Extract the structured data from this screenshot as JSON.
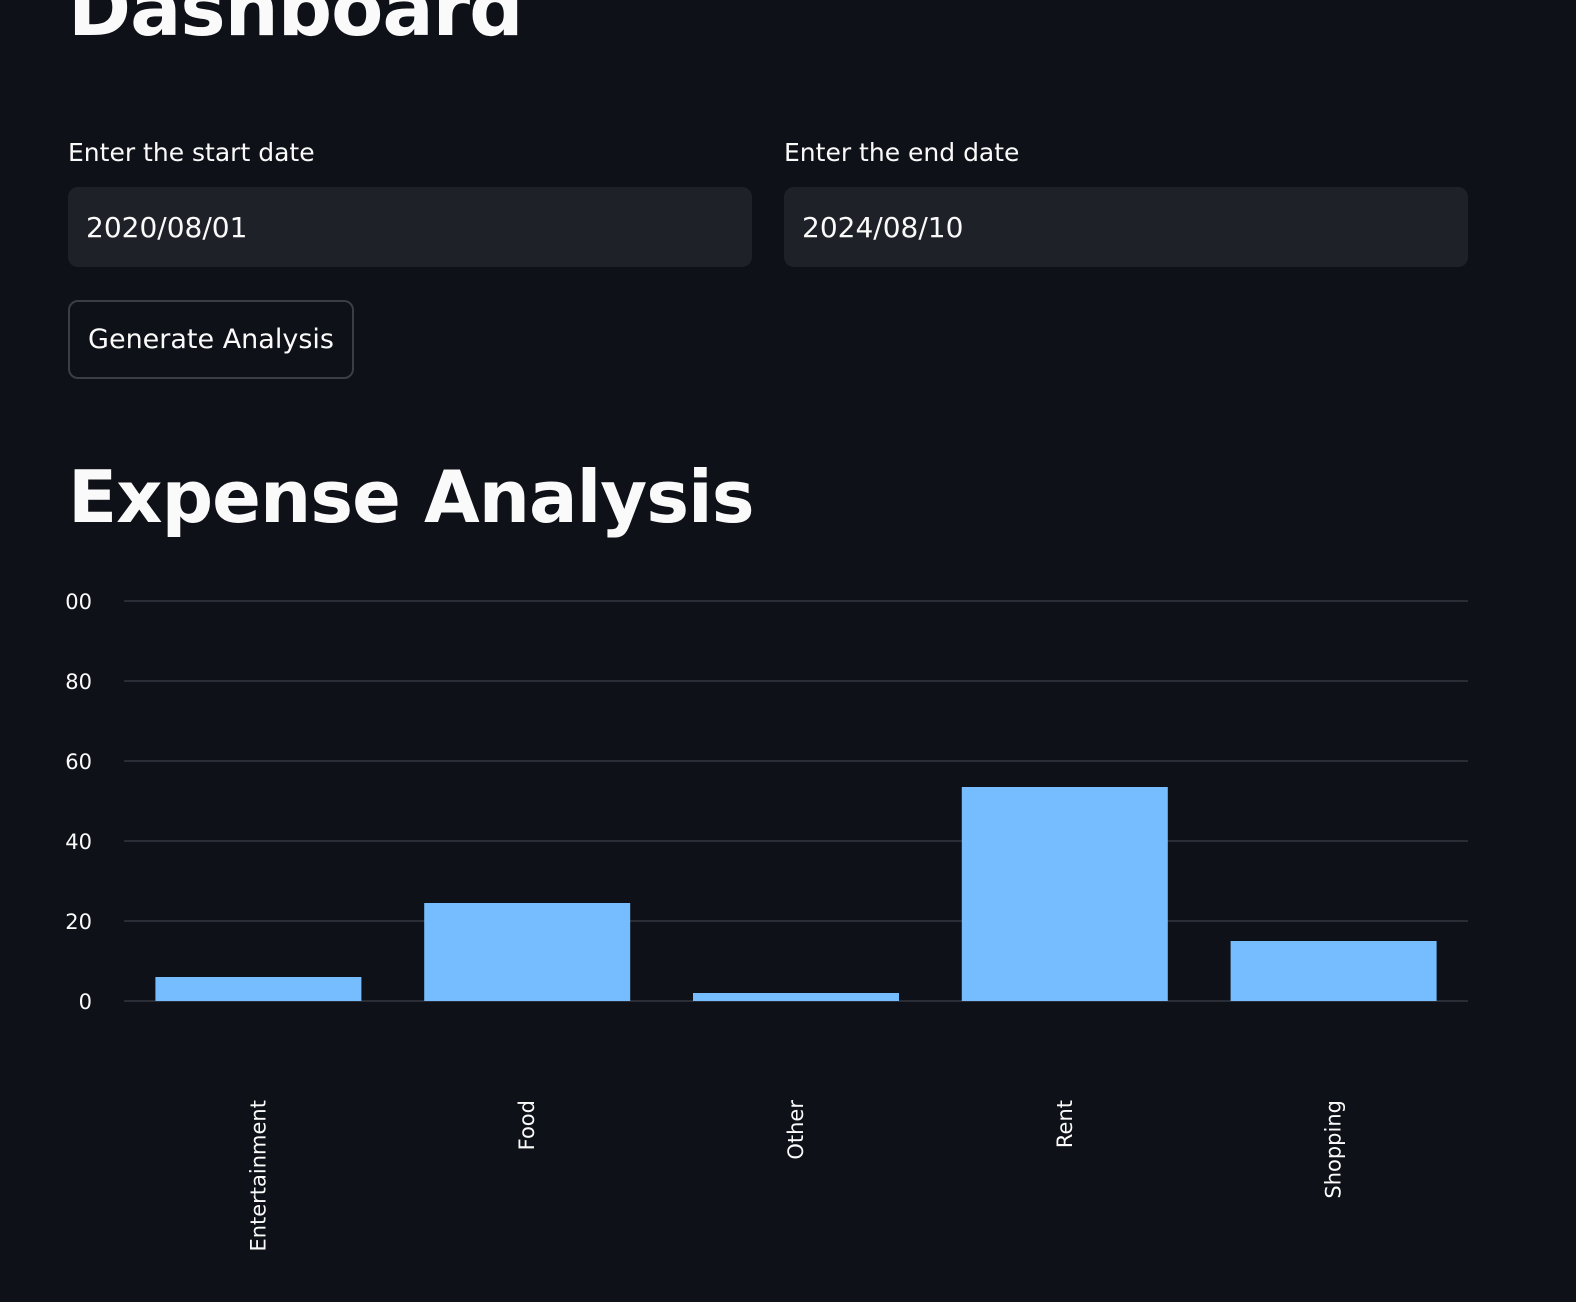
{
  "page": {
    "title": "Dashboard"
  },
  "filters": {
    "start_label": "Enter the start date",
    "start_value": "2020/08/01",
    "end_label": "Enter the end date",
    "end_value": "2024/08/10"
  },
  "actions": {
    "generate_label": "Generate Analysis"
  },
  "analysis": {
    "title": "Expense Analysis"
  },
  "colors": {
    "bar": "#76bdff",
    "grid": "#2a2d35",
    "text": "#fafafa",
    "background": "#0e1117"
  },
  "chart_data": {
    "type": "bar",
    "categories": [
      "Entertainment",
      "Food",
      "Other",
      "Rent",
      "Shopping"
    ],
    "values": [
      6,
      24.5,
      2,
      53.5,
      15
    ],
    "y_ticks": [
      "0",
      "20",
      "40",
      "60",
      "80",
      "00"
    ],
    "ylim": [
      0,
      100
    ],
    "grid": true
  }
}
